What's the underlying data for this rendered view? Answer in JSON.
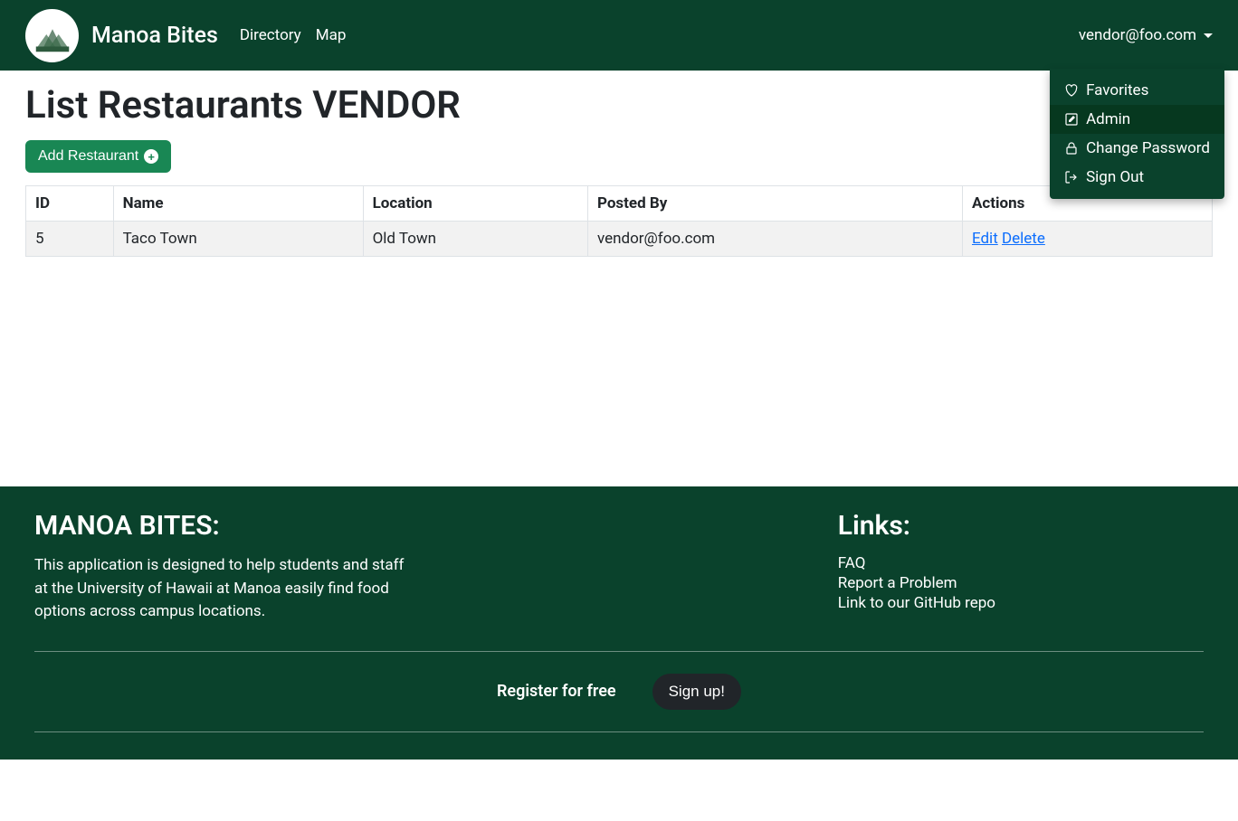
{
  "nav": {
    "brand": "Manoa Bites",
    "links": {
      "directory": "Directory",
      "map": "Map"
    },
    "user_email": "vendor@foo.com"
  },
  "dropdown": {
    "favorites": "Favorites",
    "admin": "Admin",
    "change_password": "Change Password",
    "sign_out": "Sign Out"
  },
  "page": {
    "title": "List Restaurants VENDOR",
    "add_btn": "Add Restaurant"
  },
  "table": {
    "headers": {
      "id": "ID",
      "name": "Name",
      "location": "Location",
      "posted_by": "Posted By",
      "actions": "Actions"
    },
    "rows": [
      {
        "id": "5",
        "name": "Taco Town",
        "location": "Old Town",
        "posted_by": "vendor@foo.com",
        "edit": "Edit",
        "delete": "Delete"
      }
    ]
  },
  "footer": {
    "title": "MANOA BITES:",
    "desc": "This application is designed to help students and staff at the University of Hawaii at Manoa easily find food options across campus locations.",
    "links_title": "Links:",
    "links": {
      "faq": "FAQ",
      "report": "Report a Problem",
      "github": "Link to our GitHub repo"
    },
    "cta_text": "Register for free",
    "signup": "Sign up!"
  }
}
